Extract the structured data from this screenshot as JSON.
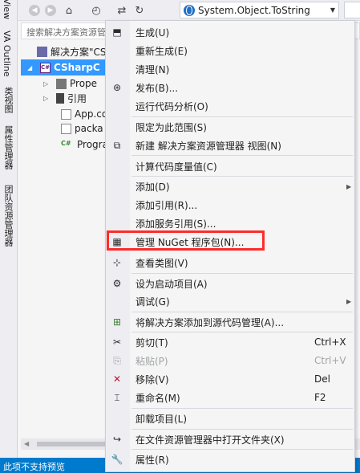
{
  "side_tabs": [
    "View",
    "VA Outline",
    "类视图",
    "属性管理器",
    "团队资源管理器"
  ],
  "toolbar": {
    "combo_value": "System.Object.ToString",
    "buttons": [
      "back-icon",
      "forward-icon",
      "home-icon",
      "history-icon",
      "sync-icon",
      "refresh-icon"
    ],
    "combo_icon": "globe-icon"
  },
  "search": {
    "placeholder": "搜索解决方案资源管理器"
  },
  "tree": {
    "solution": "解决方案\"CSh",
    "project": "CSharpC",
    "properties": "Prope",
    "references": "引用",
    "app": "App.co",
    "packages": "packa",
    "program": "Progra"
  },
  "statusbar": {
    "text": "此项不支持预览"
  },
  "menu": {
    "items": [
      {
        "label": "生成(U)",
        "icon": "build-icon"
      },
      {
        "label": "重新生成(E)",
        "icon": ""
      },
      {
        "label": "清理(N)",
        "icon": ""
      },
      {
        "label": "发布(B)...",
        "icon": "publish-icon"
      },
      {
        "label": "运行代码分析(O)",
        "icon": ""
      },
      {
        "label": "限定为此范围(S)",
        "icon": ""
      },
      {
        "label": "新建 解决方案资源管理器 视图(N)",
        "icon": "new-view-icon"
      },
      {
        "label": "计算代码度量值(C)",
        "icon": ""
      },
      {
        "label": "添加(D)",
        "icon": "",
        "submenu": true
      },
      {
        "label": "添加引用(R)...",
        "icon": ""
      },
      {
        "label": "添加服务引用(S)...",
        "icon": ""
      },
      {
        "label": "管理 NuGet 程序包(N)...",
        "icon": "nuget-icon"
      },
      {
        "label": "查看类图(V)",
        "icon": "class-diagram-icon"
      },
      {
        "label": "设为启动项目(A)",
        "icon": "gear-icon"
      },
      {
        "label": "调试(G)",
        "icon": "",
        "submenu": true
      },
      {
        "label": "将解决方案添加到源代码管理(A)...",
        "icon": "source-control-icon"
      },
      {
        "label": "剪切(T)",
        "icon": "scissors-icon",
        "shortcut": "Ctrl+X"
      },
      {
        "label": "粘贴(P)",
        "icon": "paste-icon",
        "shortcut": "Ctrl+V",
        "disabled": true
      },
      {
        "label": "移除(V)",
        "icon": "remove-icon",
        "shortcut": "Del"
      },
      {
        "label": "重命名(M)",
        "icon": "rename-icon",
        "shortcut": "F2"
      },
      {
        "label": "卸载项目(L)",
        "icon": ""
      },
      {
        "label": "在文件资源管理器中打开文件夹(X)",
        "icon": "open-folder-icon"
      },
      {
        "label": "属性(R)",
        "icon": "wrench-icon"
      }
    ]
  },
  "colors": {
    "selection": "#3399ff",
    "statusbar": "#007acc",
    "highlight_box": "#ff2b2b"
  }
}
